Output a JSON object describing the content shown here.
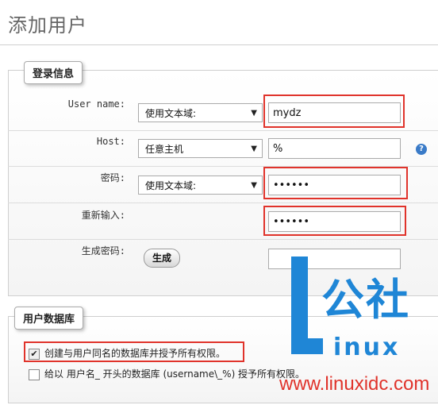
{
  "page": {
    "title": "添加用户"
  },
  "login_info": {
    "legend": "登录信息",
    "user_name": {
      "label": "User name:",
      "select": "使用文本域:",
      "value": "mydz"
    },
    "host": {
      "label": "Host:",
      "select": "任意主机",
      "value": "%",
      "help_icon": "question-icon"
    },
    "password": {
      "label": "密码:",
      "select": "使用文本域:",
      "value": "••••••"
    },
    "retype": {
      "label": "重新输入:",
      "value": "••••••"
    },
    "generate": {
      "label": "生成密码:",
      "button": "生成",
      "value": ""
    }
  },
  "user_db": {
    "legend": "用户数据库",
    "options": [
      {
        "label": "创建与用户同名的数据库并授予所有权限。",
        "checked": true
      },
      {
        "label": "给以 用户名_ 开头的数据库 (username\\_%) 授予所有权限。",
        "checked": false
      }
    ]
  },
  "watermark": {
    "brand1": "公社",
    "brand2": "inux",
    "url": "www.linuxidc.com"
  },
  "colors": {
    "highlight": "#e0332b",
    "brand": "#1f86d6"
  }
}
